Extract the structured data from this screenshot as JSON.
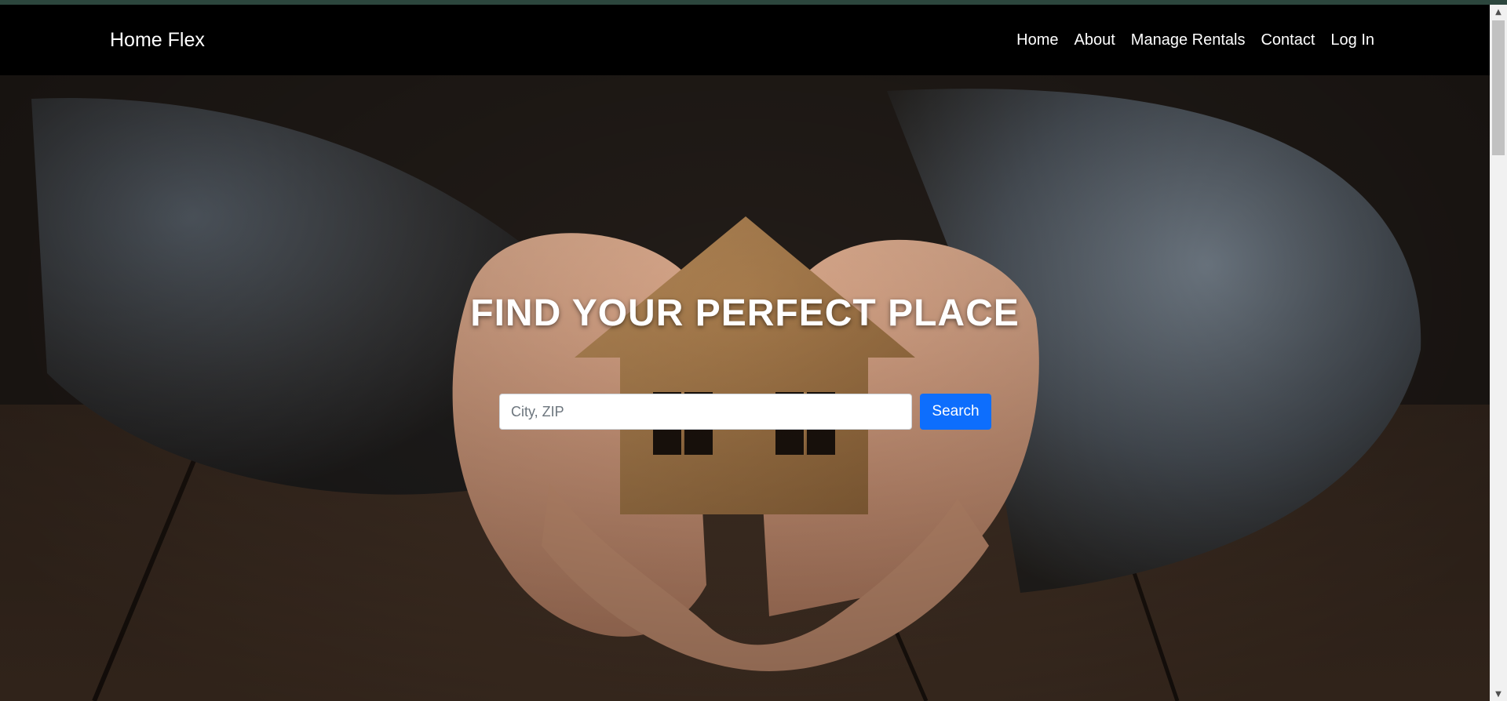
{
  "header": {
    "brand": "Home Flex",
    "nav": [
      {
        "label": "Home"
      },
      {
        "label": "About"
      },
      {
        "label": "Manage Rentals"
      },
      {
        "label": "Contact"
      },
      {
        "label": "Log In"
      }
    ]
  },
  "hero": {
    "title": "FIND YOUR PERFECT PLACE",
    "search": {
      "placeholder": "City, ZIP",
      "value": "",
      "button_label": "Search"
    }
  },
  "scrollbar": {
    "up_icon": "chevron-up-icon",
    "down_icon": "chevron-down-icon"
  },
  "colors": {
    "navbar_bg": "#000000",
    "accent": "#0d6efd",
    "text_on_dark": "#ffffff",
    "top_strip": "#2c463d"
  }
}
